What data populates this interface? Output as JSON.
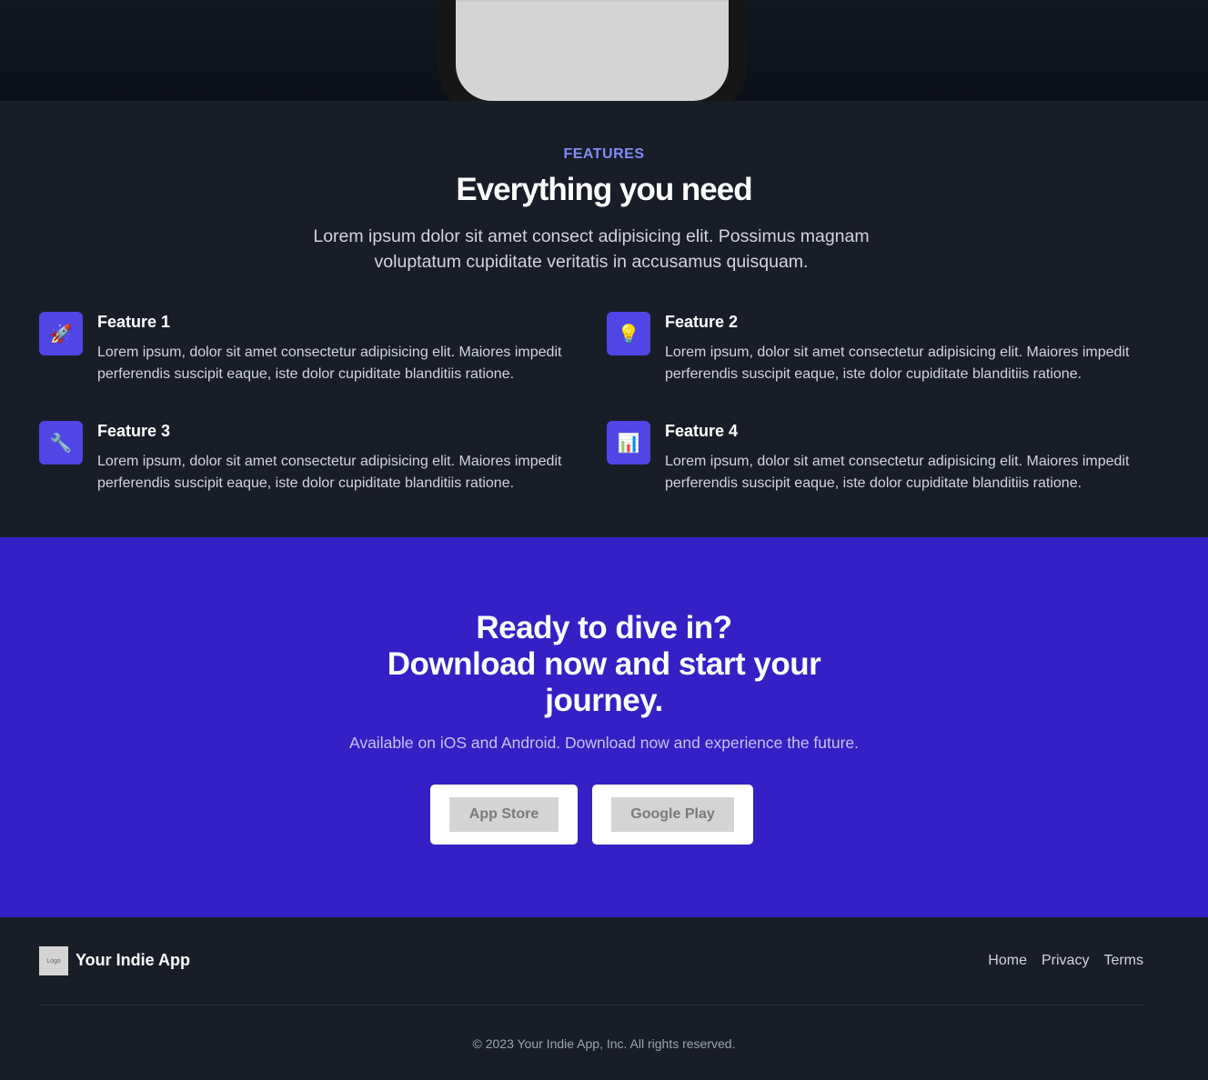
{
  "features": {
    "eyebrow": "FEATURES",
    "title": "Everything you need",
    "lead": "Lorem ipsum dolor sit amet consect adipisicing elit. Possimus magnam voluptatum cupiditate veritatis in accusamus quisquam.",
    "items": [
      {
        "icon": "rocket-icon",
        "glyph": "🚀",
        "name": "Feature 1",
        "desc": "Lorem ipsum, dolor sit amet consectetur adipisicing elit. Maiores impedit perferendis suscipit eaque, iste dolor cupiditate blanditiis ratione."
      },
      {
        "icon": "lightbulb-icon",
        "glyph": "💡",
        "name": "Feature 2",
        "desc": "Lorem ipsum, dolor sit amet consectetur adipisicing elit. Maiores impedit perferendis suscipit eaque, iste dolor cupiditate blanditiis ratione."
      },
      {
        "icon": "wrench-icon",
        "glyph": "🔧",
        "name": "Feature 3",
        "desc": "Lorem ipsum, dolor sit amet consectetur adipisicing elit. Maiores impedit perferendis suscipit eaque, iste dolor cupiditate blanditiis ratione."
      },
      {
        "icon": "bar-chart-icon",
        "glyph": "📊",
        "name": "Feature 4",
        "desc": "Lorem ipsum, dolor sit amet consectetur adipisicing elit. Maiores impedit perferendis suscipit eaque, iste dolor cupiditate blanditiis ratione."
      }
    ]
  },
  "cta": {
    "title_line1": "Ready to dive in?",
    "title_line2": "Download now and start your",
    "title_line3": "journey.",
    "subtitle": "Available on iOS and Android. Download now and experience the future.",
    "app_store_label": "App Store",
    "google_play_label": "Google Play"
  },
  "footer": {
    "logo_text": "Logo",
    "brand": "Your Indie App",
    "nav": [
      "Home",
      "Privacy",
      "Terms"
    ],
    "copyright": "© 2023 Your Indie App, Inc. All rights reserved."
  },
  "colors": {
    "accent": "#5046e5",
    "cta_background": "#3420c4",
    "page_background": "#191d28",
    "eyebrow": "#818cf8"
  }
}
